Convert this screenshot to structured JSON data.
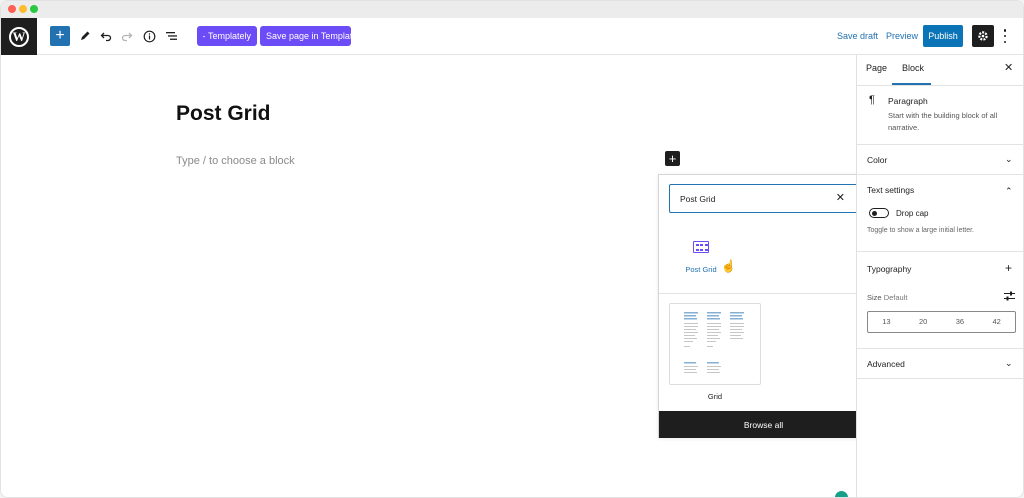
{
  "colors": {
    "accent": "#2271b1",
    "templately": "#6b4cf6",
    "publish": "#0a74b6",
    "dark": "#1e1e1e",
    "traffic_red": "#fe5f57",
    "traffic_yellow": "#febc2e",
    "traffic_green": "#28c840"
  },
  "toolbar": {
    "logo": "W",
    "inserter_icon": "plus-icon",
    "templately_label": "Templately",
    "save_templately_label": "Save page in Templately",
    "save_draft_label": "Save draft",
    "preview_label": "Preview",
    "publish_label": "Publish"
  },
  "editor": {
    "title": "Post Grid",
    "placeholder": "Type / to choose a block"
  },
  "inserter": {
    "search_value": "Post Grid",
    "results": [
      {
        "label": "Post Grid",
        "icon": "post-grid-icon"
      }
    ],
    "pattern_label": "Grid",
    "browse_all_label": "Browse all"
  },
  "sidebar": {
    "tabs": [
      "Page",
      "Block"
    ],
    "active_tab": "Block",
    "block_name": "Paragraph",
    "block_description": "Start with the building block of all narrative.",
    "panels": {
      "color": "Color",
      "text_settings": "Text settings",
      "drop_cap_label": "Drop cap",
      "drop_cap_help": "Toggle to show a large initial letter.",
      "typography": "Typography",
      "size_label": "Size",
      "size_default": "Default",
      "font_sizes": [
        "13",
        "20",
        "36",
        "42"
      ],
      "advanced": "Advanced"
    }
  }
}
